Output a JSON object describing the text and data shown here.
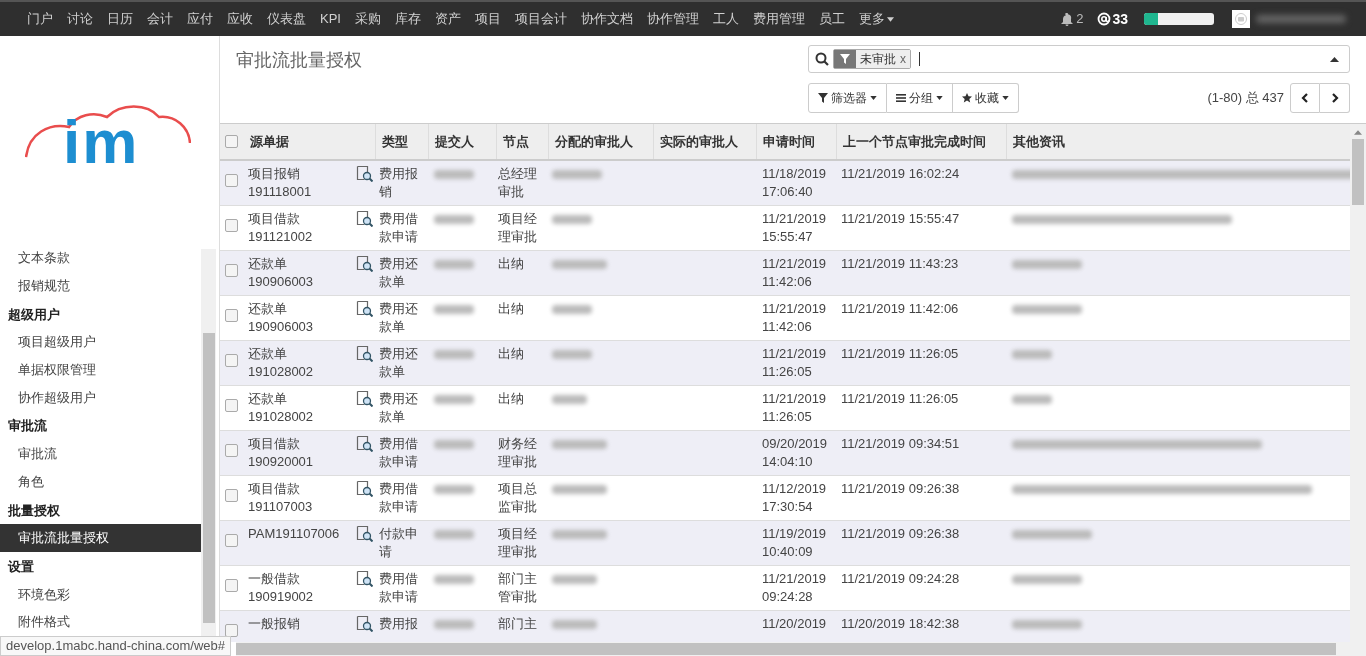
{
  "topnav": {
    "items": [
      {
        "label": "门户",
        "has_caret": false
      },
      {
        "label": "讨论",
        "has_caret": false
      },
      {
        "label": "日历",
        "has_caret": false
      },
      {
        "label": "会计",
        "has_caret": false
      },
      {
        "label": "应付",
        "has_caret": false
      },
      {
        "label": "应收",
        "has_caret": false
      },
      {
        "label": "仪表盘",
        "has_caret": false
      },
      {
        "label": "KPI",
        "has_caret": false
      },
      {
        "label": "采购",
        "has_caret": false
      },
      {
        "label": "库存",
        "has_caret": false
      },
      {
        "label": "资产",
        "has_caret": false
      },
      {
        "label": "项目",
        "has_caret": false
      },
      {
        "label": "项目会计",
        "has_caret": false
      },
      {
        "label": "协作文档",
        "has_caret": false
      },
      {
        "label": "协作管理",
        "has_caret": false
      },
      {
        "label": "工人",
        "has_caret": false
      },
      {
        "label": "费用管理",
        "has_caret": false
      },
      {
        "label": "员工",
        "has_caret": false
      },
      {
        "label": "更多",
        "has_caret": true
      }
    ],
    "notifications": "2",
    "mentions": "33",
    "progress": {
      "level": 0.2
    }
  },
  "logo": {
    "text": "im"
  },
  "sidebar": {
    "sections": [
      {
        "items": [
          {
            "label": "文本条款",
            "selected": false
          },
          {
            "label": "报销规范",
            "selected": false
          }
        ]
      },
      {
        "title": "超级用户",
        "items": [
          {
            "label": "项目超级用户",
            "selected": false
          },
          {
            "label": "单据权限管理",
            "selected": false
          },
          {
            "label": "协作超级用户",
            "selected": false
          }
        ]
      },
      {
        "title": "审批流",
        "items": [
          {
            "label": "审批流",
            "selected": false
          },
          {
            "label": "角色",
            "selected": false
          }
        ]
      },
      {
        "title": "批量授权",
        "items": [
          {
            "label": "审批流批量授权",
            "selected": true
          }
        ]
      },
      {
        "title": "设置",
        "items": [
          {
            "label": "环境色彩",
            "selected": false
          },
          {
            "label": "附件格式",
            "selected": false
          }
        ]
      }
    ]
  },
  "status_url": "develop.1mabc.hand-china.com/web#",
  "page_title": "审批流批量授权",
  "search": {
    "facets": [
      "未审批"
    ],
    "remove_mark": "x"
  },
  "buttons": [
    {
      "kind": "filter",
      "label": "筛选器"
    },
    {
      "kind": "group",
      "label": "分组"
    },
    {
      "kind": "favorite",
      "label": "收藏"
    }
  ],
  "pager": "(1-80) 总 437",
  "table": {
    "all_checked": false,
    "columns": [
      "源单据",
      "类型",
      "提交人",
      "节点",
      "分配的审批人",
      "实际的审批人",
      "申请时间",
      "上一个节点审批完成时间",
      "其他资讯"
    ],
    "rows": [
      {
        "source": "项目报销 191118001",
        "type": "费用报销",
        "node": "总经理审批",
        "requested": "11/18/2019 17:06:40",
        "previous": "11/21/2019 16:02:24",
        "checked": false
      },
      {
        "source": "项目借款 191121002",
        "type": "费用借款申请",
        "node": "项目经理审批",
        "requested": "11/21/2019 15:55:47",
        "previous": "11/21/2019 15:55:47",
        "checked": false
      },
      {
        "source": "还款单 190906003",
        "type": "费用还款单",
        "node": "出纳",
        "requested": "11/21/2019 11:42:06",
        "previous": "11/21/2019 11:43:23",
        "checked": false
      },
      {
        "source": "还款单 190906003",
        "type": "费用还款单",
        "node": "出纳",
        "requested": "11/21/2019 11:42:06",
        "previous": "11/21/2019 11:42:06",
        "checked": false
      },
      {
        "source": "还款单 191028002",
        "type": "费用还款单",
        "node": "出纳",
        "requested": "11/21/2019 11:26:05",
        "previous": "11/21/2019 11:26:05",
        "checked": false
      },
      {
        "source": "还款单 191028002",
        "type": "费用还款单",
        "node": "出纳",
        "requested": "11/21/2019 11:26:05",
        "previous": "11/21/2019 11:26:05",
        "checked": false
      },
      {
        "source": "项目借款 190920001",
        "type": "费用借款申请",
        "node": "财务经理审批",
        "requested": "09/20/2019 14:04:10",
        "previous": "11/21/2019 09:34:51",
        "checked": false
      },
      {
        "source": "项目借款 191107003",
        "type": "费用借款申请",
        "node": "项目总监审批",
        "requested": "11/12/2019 17:30:54",
        "previous": "11/21/2019 09:26:38",
        "checked": false
      },
      {
        "source": "PAM191107006",
        "type": "付款申请",
        "node": "项目经理审批",
        "requested": "11/19/2019 10:40:09",
        "previous": "11/21/2019 09:26:38",
        "checked": false
      },
      {
        "source": "一般借款 190919002",
        "type": "费用借款申请",
        "node": "部门主管审批",
        "requested": "11/21/2019 09:24:28",
        "previous": "11/21/2019 09:24:28",
        "checked": false
      },
      {
        "source": "一般报销",
        "type": "费用报",
        "node": "部门主",
        "requested": "11/20/2019",
        "previous": "11/20/2019 18:42:38",
        "checked": false
      }
    ]
  }
}
